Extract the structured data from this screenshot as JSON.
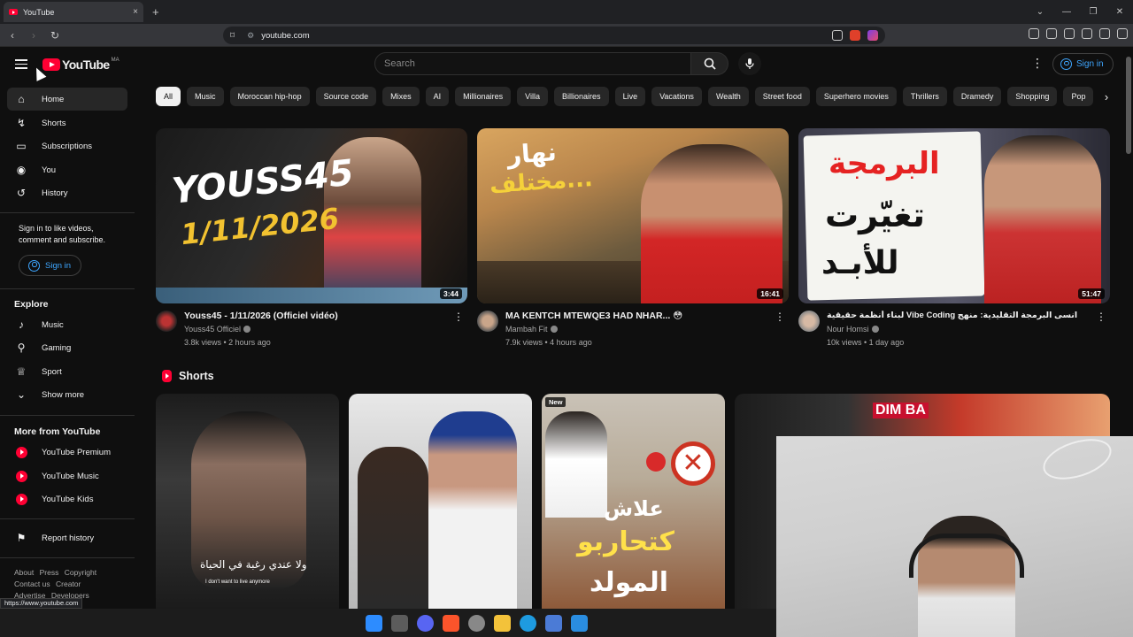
{
  "browser": {
    "tab_title": "YouTube",
    "tab_close": "×",
    "new_tab": "+",
    "url": "youtube.com",
    "status_url": "https://www.youtube.com"
  },
  "masthead": {
    "logo_text": "YouTube",
    "country": "MA",
    "search_placeholder": "Search",
    "sign_in": "Sign in"
  },
  "sidebar": {
    "main": [
      {
        "label": "Home",
        "icon": "home-icon",
        "active": true
      },
      {
        "label": "Shorts",
        "icon": "shorts-icon"
      },
      {
        "label": "Subscriptions",
        "icon": "subscriptions-icon"
      },
      {
        "label": "You",
        "icon": "you-icon"
      },
      {
        "label": "History",
        "icon": "history-icon"
      }
    ],
    "signin_note": "Sign in to like videos, comment and subscribe.",
    "signin_button": "Sign in",
    "explore_heading": "Explore",
    "explore": [
      {
        "label": "Music",
        "icon": "music-icon"
      },
      {
        "label": "Gaming",
        "icon": "gaming-icon"
      },
      {
        "label": "Sport",
        "icon": "trophy-icon"
      },
      {
        "label": "Show more",
        "icon": "chevron-down-icon"
      }
    ],
    "more_heading": "More from YouTube",
    "more": [
      {
        "label": "YouTube Premium"
      },
      {
        "label": "YouTube Music"
      },
      {
        "label": "YouTube Kids"
      }
    ],
    "report": "Report history",
    "footer": [
      "About",
      "Press",
      "Copyright",
      "Contact us",
      "Creator",
      "Advertise",
      "Developers"
    ]
  },
  "chips": [
    "All",
    "Music",
    "Moroccan hip-hop",
    "Source code",
    "Mixes",
    "AI",
    "Millionaires",
    "Villa",
    "Billionaires",
    "Live",
    "Vacations",
    "Wealth",
    "Street food",
    "Superhero movies",
    "Thrillers",
    "Dramedy",
    "Shopping",
    "Pop"
  ],
  "videos": [
    {
      "title": "Youss45 - 1/11/2026  (Officiel vidéo)",
      "channel": "Youss45 Officiel",
      "stats": "3.8k views • 2 hours ago",
      "duration": "3:44",
      "thumb_text_1": "YOUSS45",
      "thumb_text_2": "1/11/2026"
    },
    {
      "title": "MA KENTCH MTEWQE3 HAD NHAR... 😳",
      "channel": "Mambah Fit",
      "stats": "7.9k views • 4 hours ago",
      "duration": "16:41",
      "thumb_text_1": "نهار",
      "thumb_text_2": "مختلف..."
    },
    {
      "title": "انسى البرمجة التقليدية: منهج Vibe Coding لبناء أنظمة حقيقية",
      "channel": "Nour Homsi",
      "stats": "10k views • 1 day ago",
      "duration": "51:47",
      "thumb_text_1": "البرمجة",
      "thumb_text_2": "تغيّرت",
      "thumb_text_3": "للأبـد"
    }
  ],
  "shorts": {
    "heading": "Shorts",
    "items": [
      {
        "caption": "ولا عندي رغبة في الحياة",
        "sub": "I don't want to live anymore"
      },
      {
        "caption": ""
      },
      {
        "badge": "New",
        "caption_1": "علاش",
        "caption_2": "كتحاربو",
        "caption_3": "المولد"
      },
      {
        "caption": "DIM BA"
      }
    ]
  }
}
